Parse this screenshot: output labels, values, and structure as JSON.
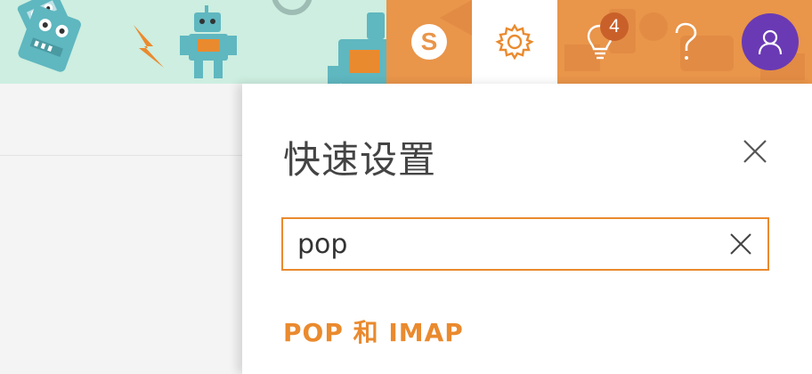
{
  "header": {
    "toolbar": {
      "skype": {
        "icon": "skype-icon"
      },
      "settings": {
        "icon": "gear-icon",
        "active": true
      },
      "tips": {
        "icon": "lightbulb-icon",
        "badge_count": "4"
      },
      "help": {
        "icon": "question-icon"
      },
      "account": {
        "icon": "person-icon"
      }
    },
    "colors": {
      "toolbar_bg": "#e9954a",
      "accent": "#ea8a2e",
      "avatar_bg": "#6a3ab4",
      "banner_bg": "#cdeee0",
      "robot": "#5fb7c0"
    }
  },
  "quick_settings": {
    "title": "快速设置",
    "close_icon": "close-icon",
    "search": {
      "value": "pop",
      "placeholder": "",
      "clear_icon": "close-icon"
    },
    "results": [
      {
        "label": "POP 和 IMAP"
      }
    ]
  }
}
